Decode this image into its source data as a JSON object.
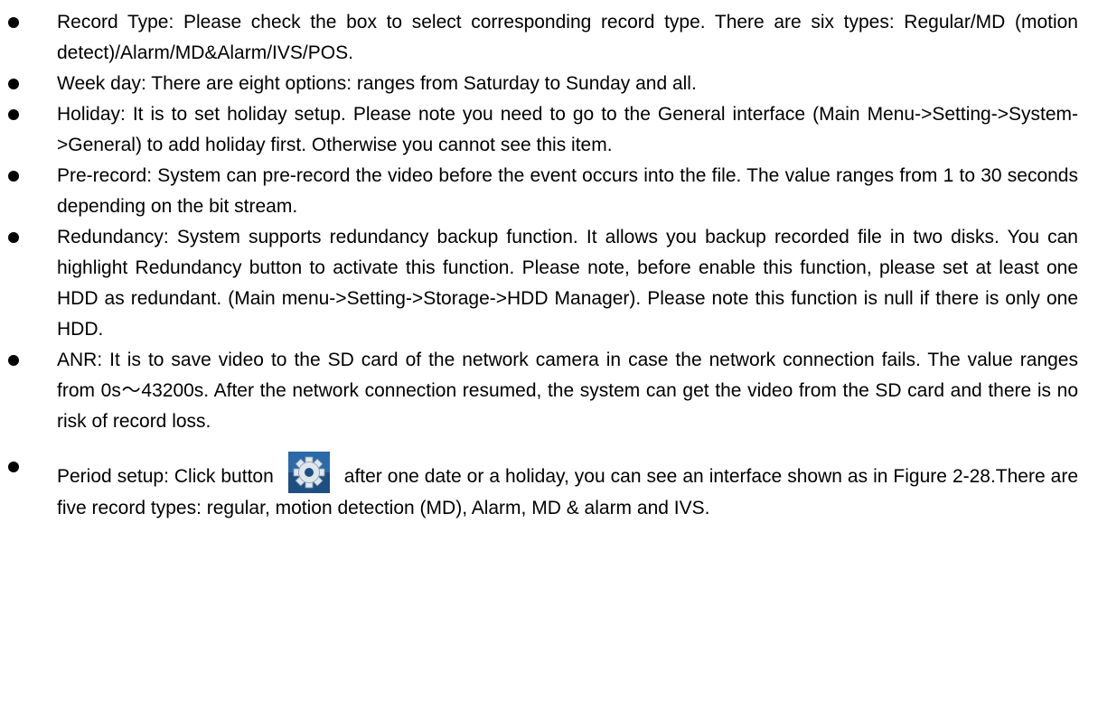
{
  "bullets": [
    {
      "text": "Record Type: Please check the box to select corresponding record type. There are six types: Regular/MD (motion detect)/Alarm/MD&Alarm/IVS/POS."
    },
    {
      "text": "Week day: There are eight options: ranges from Saturday to Sunday and all."
    },
    {
      "text": "Holiday: It is to set holiday setup. Please note you need to go to the General interface (Main Menu->Setting->System->General) to add holiday first. Otherwise you cannot see this item."
    },
    {
      "text": "Pre-record: System can pre-record the video before the event occurs into the file. The value ranges from 1 to 30 seconds depending on the bit stream."
    },
    {
      "text": "Redundancy: System supports redundancy backup function. It allows you backup recorded file in two disks. You can highlight Redundancy button to activate this function. Please note, before enable this function, please set at least one HDD as redundant. (Main menu->Setting->Storage->HDD Manager). Please note this function is null if there is only one HDD."
    },
    {
      "text": "ANR: It is to save video to the SD card of the network camera in case the network connection fails. The value ranges from 0s～43200s. After the network connection resumed, the system can get the video from the SD card and there is no risk of record loss."
    },
    {
      "text_before": "Period setup: Click button",
      "icon": "gear-icon",
      "text_after": "after one date or a holiday, you can see an interface shown as in Figure 2-28.There are five record types: regular, motion detection (MD), Alarm, MD & alarm and IVS."
    }
  ]
}
